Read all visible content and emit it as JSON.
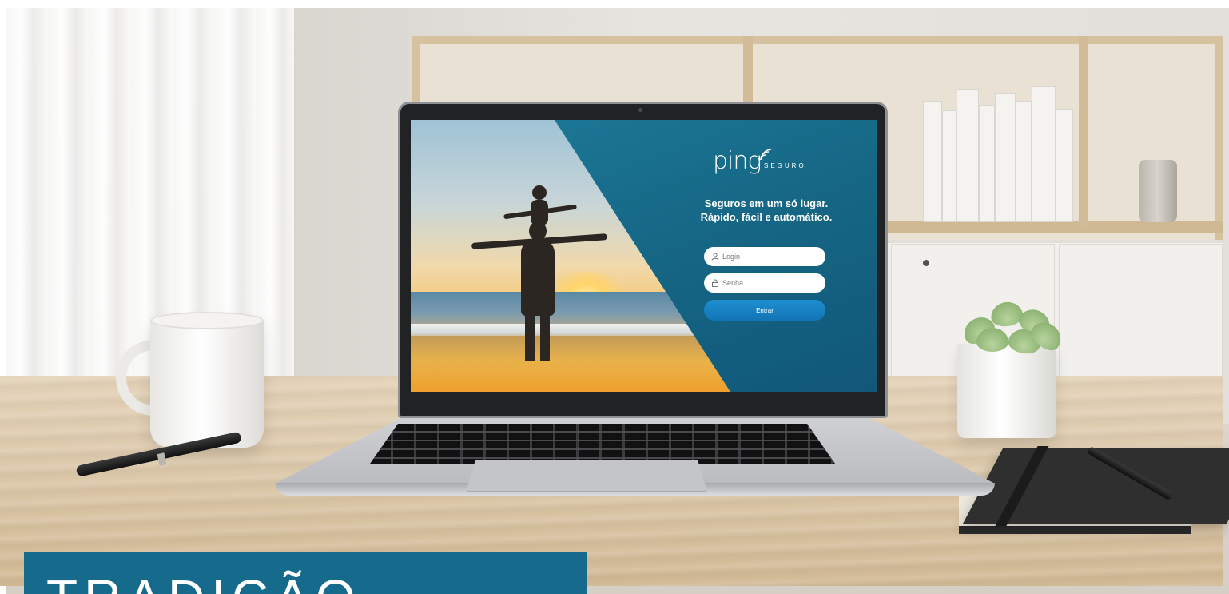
{
  "screen": {
    "logo": {
      "wordmark": "ping",
      "subtitle": "SEGURO"
    },
    "tagline": [
      "Seguros em um só lugar.",
      "Rápido, fácil e automático."
    ],
    "login_field": {
      "placeholder": "Login",
      "icon": "user-icon"
    },
    "password_field": {
      "placeholder": "Senha",
      "icon": "lock-icon"
    },
    "submit_button": {
      "label": "Entrar"
    },
    "colors": {
      "panel": "#156583",
      "button": "#1275b5",
      "field": "#ffffff"
    }
  },
  "banner": {
    "text": "TRADIÇÃO",
    "color": "#166a8c"
  }
}
